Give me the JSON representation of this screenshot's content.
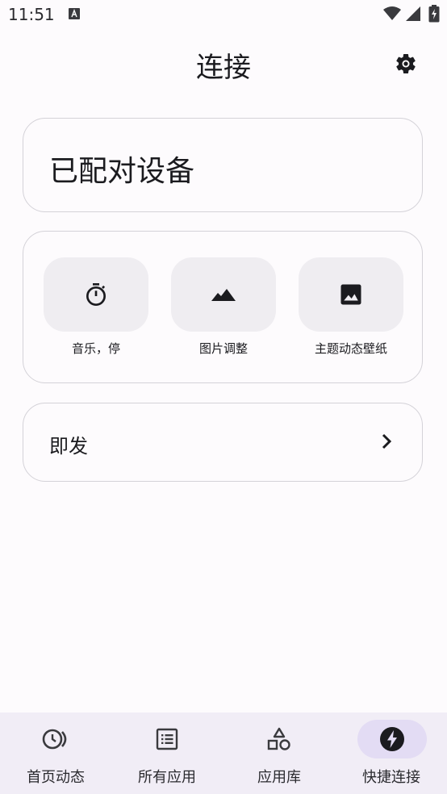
{
  "status_bar": {
    "time": "11:51",
    "icons": [
      "notification-a-icon",
      "wifi-icon",
      "signal-icon",
      "battery-charging-icon"
    ]
  },
  "header": {
    "title": "连接",
    "settings_icon": "gear-icon"
  },
  "paired_devices": {
    "label": "已配对设备"
  },
  "tiles": [
    {
      "label": "音乐，停",
      "icon": "timer-icon"
    },
    {
      "label": "图片调整",
      "icon": "landscape-icon"
    },
    {
      "label": "主题动态壁纸",
      "icon": "image-icon"
    }
  ],
  "instant": {
    "label": "即发",
    "icon": "chevron-right-icon"
  },
  "bottom_nav": {
    "items": [
      {
        "label": "首页动态",
        "icon": "history-icon",
        "active": false
      },
      {
        "label": "所有应用",
        "icon": "list-icon",
        "active": false
      },
      {
        "label": "应用库",
        "icon": "shapes-icon",
        "active": false
      },
      {
        "label": "快捷连接",
        "icon": "bolt-icon",
        "active": true
      }
    ]
  },
  "colors": {
    "background": "#fdfbfd",
    "card_border": "#d4d2d8",
    "tile_background": "#efedf1",
    "nav_background": "#f1edf6",
    "nav_active_pill": "#e3dcf4",
    "text": "#1b1b1f"
  }
}
